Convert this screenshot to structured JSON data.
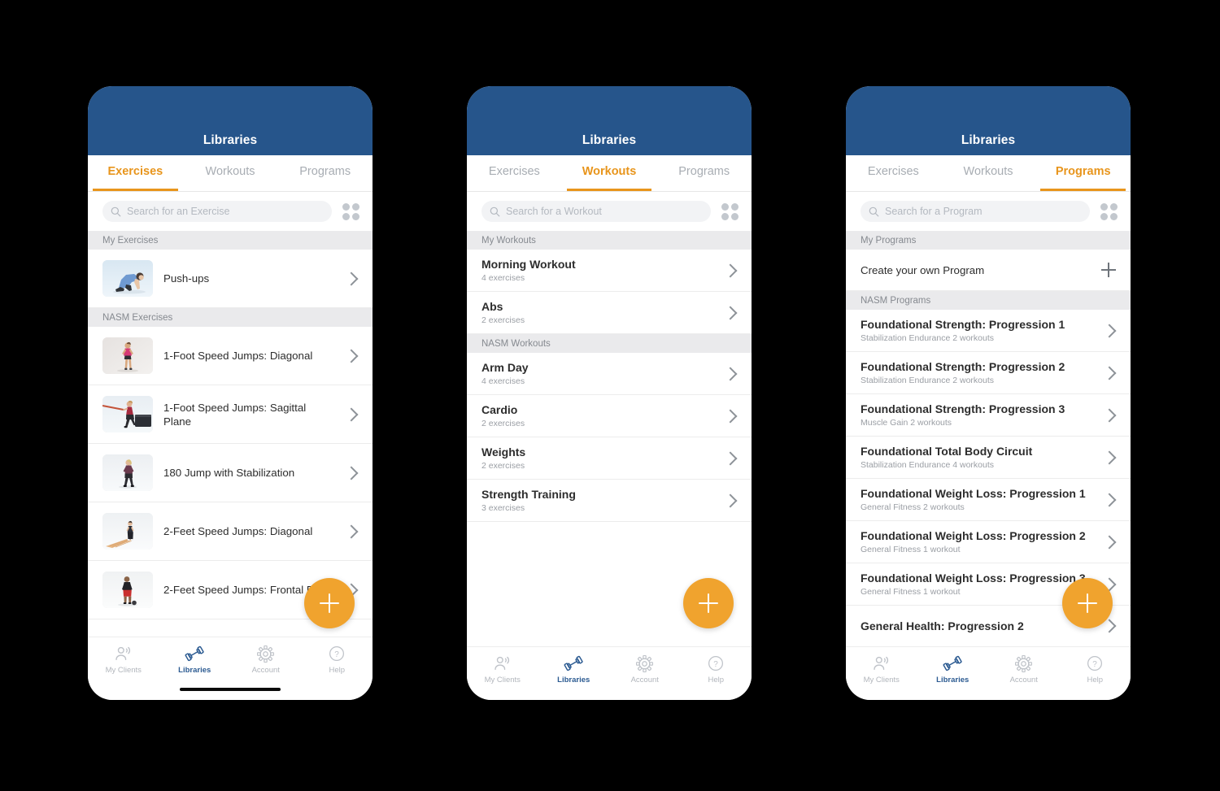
{
  "app": {
    "header_title": "Libraries",
    "header_color": "#26558B",
    "accent_color": "#E8951C",
    "fab_color": "#F0A32E",
    "nav_active_color": "#2B5A91"
  },
  "tabs": [
    {
      "label": "Exercises"
    },
    {
      "label": "Workouts"
    },
    {
      "label": "Programs"
    }
  ],
  "bottom_nav": [
    {
      "label": "My Clients",
      "icon": "people-icon"
    },
    {
      "label": "Libraries",
      "icon": "dumbbell-icon"
    },
    {
      "label": "Account",
      "icon": "gear-icon"
    },
    {
      "label": "Help",
      "icon": "question-circle-icon"
    }
  ],
  "fab": {
    "icon": "plus-icon",
    "label": "+"
  },
  "grid_toggle": {
    "icon": "grid-view-icon"
  },
  "search_icon": {
    "icon": "search-icon"
  },
  "screens": [
    {
      "id": "exercises",
      "active_tab": "Exercises",
      "search_placeholder": "Search for an Exercise",
      "search_value": "",
      "has_home_indicator": true,
      "sections": [
        {
          "title": "My Exercises",
          "items": [
            {
              "title": "Push-ups",
              "thumb": "pushup-thumb",
              "accessory": "chevron-right-icon"
            }
          ]
        },
        {
          "title": "NASM Exercises",
          "items": [
            {
              "title": "1-Foot Speed Jumps: Diagonal",
              "thumb": "speed-jump-diagonal-thumb",
              "accessory": "chevron-right-icon"
            },
            {
              "title": "1-Foot Speed Jumps: Sagittal Plane",
              "thumb": "sagittal-plane-thumb",
              "accessory": "chevron-right-icon"
            },
            {
              "title": "180 Jump with Stabilization",
              "thumb": "jump-stabilization-thumb",
              "accessory": "chevron-right-icon"
            },
            {
              "title": "2-Feet Speed Jumps: Diagonal",
              "thumb": "two-feet-diagonal-thumb",
              "accessory": "chevron-right-icon"
            },
            {
              "title": "2-Feet Speed Jumps: Frontal Plane",
              "thumb": "frontal-plane-thumb",
              "accessory": "chevron-right-icon"
            }
          ]
        }
      ]
    },
    {
      "id": "workouts",
      "active_tab": "Workouts",
      "search_placeholder": "Search for a Workout",
      "search_value": "",
      "has_home_indicator": false,
      "sections": [
        {
          "title": "My Workouts",
          "items": [
            {
              "title": "Morning Workout",
              "subtitle": "4 exercises",
              "accessory": "chevron-right-icon"
            },
            {
              "title": "Abs",
              "subtitle": "2 exercises",
              "accessory": "chevron-right-icon"
            }
          ]
        },
        {
          "title": "NASM Workouts",
          "items": [
            {
              "title": "Arm Day",
              "subtitle": "4 exercises",
              "accessory": "chevron-right-icon"
            },
            {
              "title": "Cardio",
              "subtitle": "2 exercises",
              "accessory": "chevron-right-icon"
            },
            {
              "title": "Weights",
              "subtitle": "2 exercises",
              "accessory": "chevron-right-icon"
            },
            {
              "title": "Strength Training",
              "subtitle": "3 exercises",
              "accessory": "chevron-right-icon"
            }
          ]
        }
      ]
    },
    {
      "id": "programs",
      "active_tab": "Programs",
      "search_placeholder": "Search for a Program",
      "search_value": "",
      "has_home_indicator": false,
      "sections": [
        {
          "title": "My Programs",
          "items": [
            {
              "title": "Create your own Program",
              "accessory": "plus-icon"
            }
          ]
        },
        {
          "title": "NASM Programs",
          "items": [
            {
              "title": "Foundational Strength: Progression 1",
              "subtitle": "Stabilization Endurance  2 workouts",
              "accessory": "chevron-right-icon"
            },
            {
              "title": "Foundational Strength: Progression 2",
              "subtitle": "Stabilization Endurance  2 workouts",
              "accessory": "chevron-right-icon"
            },
            {
              "title": "Foundational Strength: Progression 3",
              "subtitle": "Muscle Gain  2 workouts",
              "accessory": "chevron-right-icon"
            },
            {
              "title": "Foundational Total Body Circuit",
              "subtitle": "Stabilization Endurance  4 workouts",
              "accessory": "chevron-right-icon"
            },
            {
              "title": "Foundational Weight Loss: Progression 1",
              "subtitle": "General Fitness  2 workouts",
              "accessory": "chevron-right-icon"
            },
            {
              "title": "Foundational Weight Loss: Progression 2",
              "subtitle": "General Fitness  1 workout",
              "accessory": "chevron-right-icon"
            },
            {
              "title": "Foundational Weight Loss: Progression 3",
              "subtitle": "General Fitness  1 workout",
              "accessory": "chevron-right-icon"
            },
            {
              "title": "General Health: Progression 2",
              "subtitle": "",
              "accessory": "chevron-right-icon"
            }
          ]
        }
      ]
    }
  ]
}
